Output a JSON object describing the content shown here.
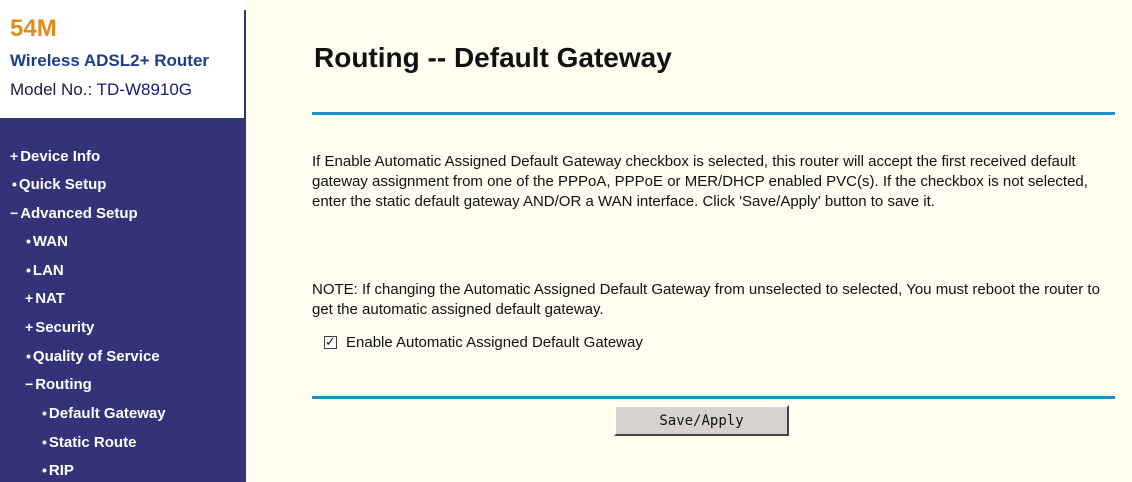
{
  "brand": {
    "speed": "54M",
    "product": "Wireless ADSL2+ Router",
    "model_label": "Model No.: ",
    "model_value": "TD-W8910G"
  },
  "nav": {
    "items": [
      {
        "mark": "+",
        "label": "Device Info"
      },
      {
        "mark": "•",
        "label": "Quick Setup"
      },
      {
        "mark": "−",
        "label": "Advanced Setup"
      },
      {
        "mark": "•",
        "label": "WAN"
      },
      {
        "mark": "•",
        "label": "LAN"
      },
      {
        "mark": "+",
        "label": "NAT"
      },
      {
        "mark": "+",
        "label": "Security"
      },
      {
        "mark": "•",
        "label": "Quality of Service"
      },
      {
        "mark": "−",
        "label": "Routing"
      },
      {
        "mark": "•",
        "label": "Default Gateway"
      },
      {
        "mark": "•",
        "label": "Static Route"
      },
      {
        "mark": "•",
        "label": "RIP"
      }
    ]
  },
  "main": {
    "title": "Routing -- Default Gateway",
    "description": "If Enable Automatic Assigned Default Gateway checkbox is selected, this router will accept the first received default gateway assignment from one of the PPPoA, PPPoE or MER/DHCP enabled PVC(s). If the checkbox is not selected, enter the static default gateway AND/OR a WAN interface. Click 'Save/Apply' button to save it.",
    "note": "NOTE: If changing the Automatic Assigned Default Gateway from unselected to selected, You must reboot the router to get the automatic assigned default gateway.",
    "checkbox_label": "Enable Automatic Assigned Default Gateway",
    "checkbox_checked": true,
    "check_glyph": "✓",
    "save_label": "Save/Apply"
  },
  "colors": {
    "nav_bg": "#33337a",
    "accent_rule": "#1f8fc8",
    "page_bg": "#fffdef",
    "brand_speed": "#e08a1c",
    "brand_product": "#1c3e8a"
  }
}
